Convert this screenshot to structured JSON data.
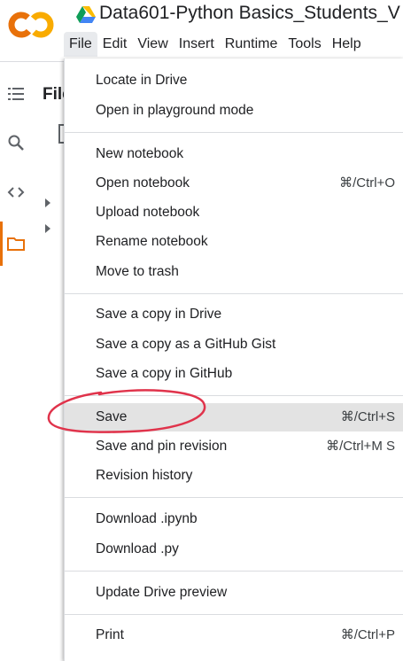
{
  "app": {
    "logo_text": "CO",
    "notebook_title": "Data601-Python Basics_Students_V"
  },
  "menubar": [
    "File",
    "Edit",
    "View",
    "Insert",
    "Runtime",
    "Tools",
    "Help"
  ],
  "sidebar": {
    "files_label": "Files",
    "icons": [
      "table-of-contents-icon",
      "search-icon",
      "code-snippets-icon",
      "folder-icon"
    ]
  },
  "file_menu": {
    "groups": [
      [
        {
          "label": "Locate in Drive",
          "shortcut": ""
        },
        {
          "label": "Open in playground mode",
          "shortcut": ""
        }
      ],
      [
        {
          "label": "New notebook",
          "shortcut": ""
        },
        {
          "label": "Open notebook",
          "shortcut": "⌘/Ctrl+O"
        },
        {
          "label": "Upload notebook",
          "shortcut": ""
        },
        {
          "label": "Rename notebook",
          "shortcut": ""
        },
        {
          "label": "Move to trash",
          "shortcut": ""
        }
      ],
      [
        {
          "label": "Save a copy in Drive",
          "shortcut": ""
        },
        {
          "label": "Save a copy as a GitHub Gist",
          "shortcut": ""
        },
        {
          "label": "Save a copy in GitHub",
          "shortcut": ""
        }
      ],
      [
        {
          "label": "Save",
          "shortcut": "⌘/Ctrl+S"
        },
        {
          "label": "Save and pin revision",
          "shortcut": "⌘/Ctrl+M S"
        },
        {
          "label": "Revision history",
          "shortcut": ""
        }
      ],
      [
        {
          "label": "Download .ipynb",
          "shortcut": ""
        },
        {
          "label": "Download .py",
          "shortcut": ""
        }
      ],
      [
        {
          "label": "Update Drive preview",
          "shortcut": ""
        }
      ],
      [
        {
          "label": "Print",
          "shortcut": "⌘/Ctrl+P"
        }
      ]
    ],
    "highlighted_item": "Save"
  },
  "colors": {
    "logo_orange": "#F9AB00",
    "logo_dark_orange": "#E8710A",
    "annotation_red": "#E0334B",
    "hover_bg": "#E3E3E3"
  }
}
